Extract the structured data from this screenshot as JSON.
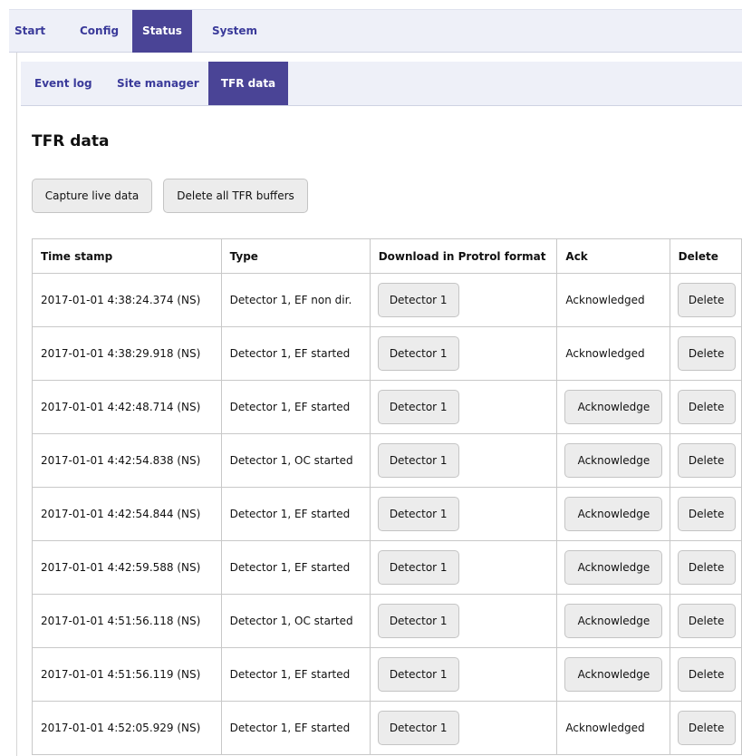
{
  "top_nav": {
    "tabs": [
      {
        "label": "Start"
      },
      {
        "label": "Config"
      },
      {
        "label": "Status"
      },
      {
        "label": "System"
      }
    ],
    "active": "Status"
  },
  "sub_nav": {
    "tabs": [
      {
        "label": "Event log"
      },
      {
        "label": "Site manager"
      },
      {
        "label": "TFR data"
      }
    ],
    "active": "TFR data"
  },
  "page_title": "TFR data",
  "actions": {
    "capture_label": "Capture live data",
    "delete_all_label": "Delete all TFR buffers"
  },
  "table": {
    "headers": [
      "Time stamp",
      "Type",
      "Download in Protrol format",
      "Ack",
      "Delete"
    ],
    "rows": [
      {
        "timestamp": "2017-01-01 4:38:24.374 (NS)",
        "type": "Detector 1, EF non dir.",
        "download": "Detector 1",
        "ack": "Acknowledged",
        "ack_is_button": false,
        "delete": "Delete"
      },
      {
        "timestamp": "2017-01-01 4:38:29.918 (NS)",
        "type": "Detector 1, EF started",
        "download": "Detector 1",
        "ack": "Acknowledged",
        "ack_is_button": false,
        "delete": "Delete"
      },
      {
        "timestamp": "2017-01-01 4:42:48.714 (NS)",
        "type": "Detector 1, EF started",
        "download": "Detector 1",
        "ack": "Acknowledge",
        "ack_is_button": true,
        "delete": "Delete"
      },
      {
        "timestamp": "2017-01-01 4:42:54.838 (NS)",
        "type": "Detector 1, OC started",
        "download": "Detector 1",
        "ack": "Acknowledge",
        "ack_is_button": true,
        "delete": "Delete"
      },
      {
        "timestamp": "2017-01-01 4:42:54.844 (NS)",
        "type": "Detector 1, EF started",
        "download": "Detector 1",
        "ack": "Acknowledge",
        "ack_is_button": true,
        "delete": "Delete"
      },
      {
        "timestamp": "2017-01-01 4:42:59.588 (NS)",
        "type": "Detector 1, EF started",
        "download": "Detector 1",
        "ack": "Acknowledge",
        "ack_is_button": true,
        "delete": "Delete"
      },
      {
        "timestamp": "2017-01-01 4:51:56.118 (NS)",
        "type": "Detector 1, OC started",
        "download": "Detector 1",
        "ack": "Acknowledge",
        "ack_is_button": true,
        "delete": "Delete"
      },
      {
        "timestamp": "2017-01-01 4:51:56.119 (NS)",
        "type": "Detector 1, EF started",
        "download": "Detector 1",
        "ack": "Acknowledge",
        "ack_is_button": true,
        "delete": "Delete"
      },
      {
        "timestamp": "2017-01-01 4:52:05.929 (NS)",
        "type": "Detector 1, EF started",
        "download": "Detector 1",
        "ack": "Acknowledged",
        "ack_is_button": false,
        "delete": "Delete"
      }
    ]
  },
  "colors": {
    "nav_bg": "#eef0f8",
    "nav_active": "#4a4496",
    "nav_text": "#3a3a9a",
    "button_bg": "#ececec"
  }
}
